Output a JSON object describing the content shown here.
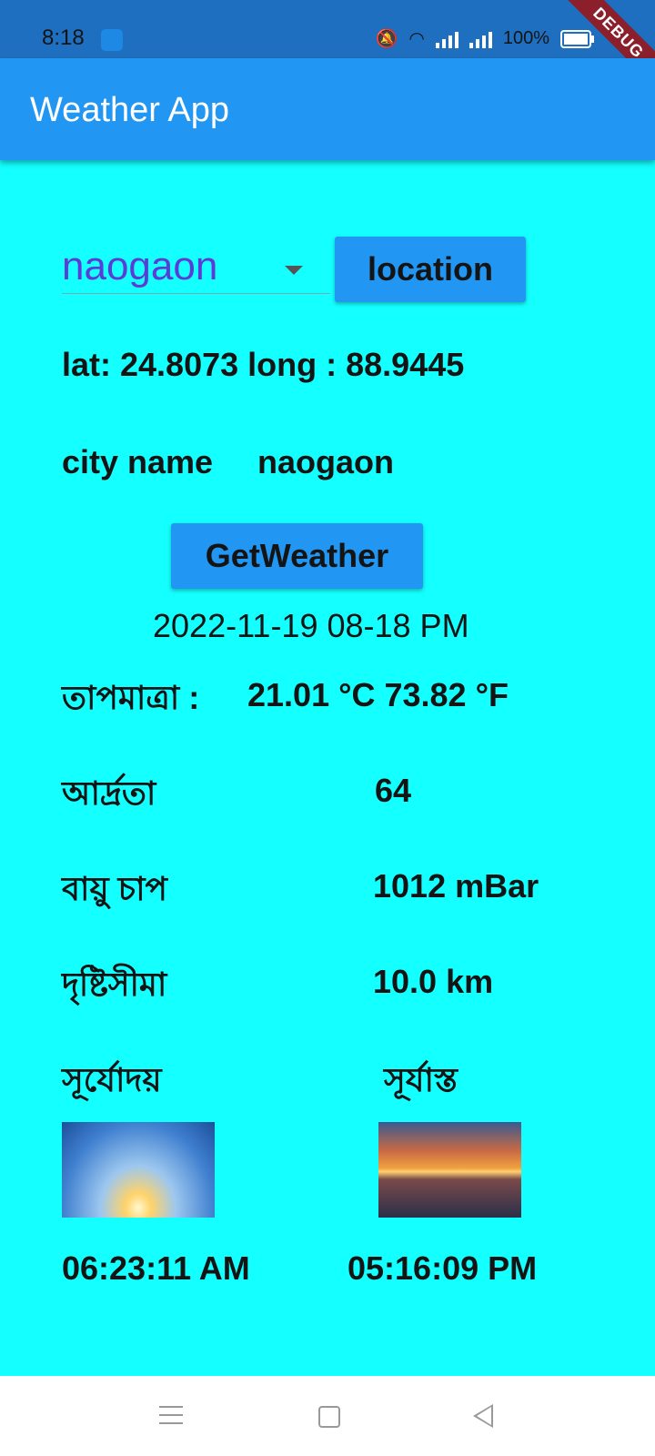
{
  "status_bar": {
    "time": "8:18",
    "battery": "100%",
    "debug_banner": "DEBUG"
  },
  "app_bar": {
    "title": "Weather App"
  },
  "location_select": {
    "selected": "naogaon"
  },
  "location_button": {
    "label": "location"
  },
  "coordinates": {
    "text": "lat: 24.8073  long : 88.9445"
  },
  "city": {
    "label": "city name",
    "value": "naogaon"
  },
  "get_weather_button": {
    "label": "GetWeather"
  },
  "datetime": "2022-11-19 08-18 PM",
  "temperature": {
    "label": "তাপমাত্রা :",
    "value": "21.01 °C  73.82 °F"
  },
  "humidity": {
    "label": "আর্দ্রতা",
    "value": "64"
  },
  "pressure": {
    "label": "বায়ু চাপ",
    "value": "1012 mBar"
  },
  "visibility": {
    "label": "দৃষ্টিসীমা",
    "value": "10.0 km"
  },
  "sun": {
    "sunrise_label": "সূর্যোদয়",
    "sunset_label": "সূর্যাস্ত",
    "sunrise_time": "06:23:11 AM",
    "sunset_time": "05:16:09 PM"
  },
  "colors": {
    "background": "#14FFFF",
    "app_bar": "#2196F3",
    "status_bar": "#1F6FC0",
    "dropdown_text": "#5C3BD6"
  }
}
